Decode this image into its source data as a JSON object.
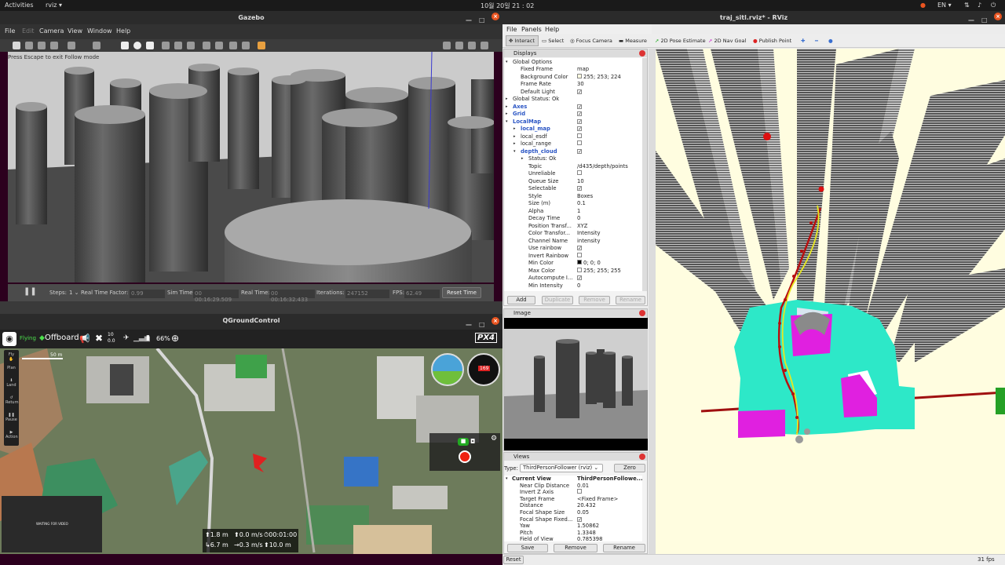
{
  "topbar": {
    "activities": "Activities",
    "app": "rviz ▾",
    "clock": "10월 20일 21 : 02",
    "lang": "EN ▾"
  },
  "gazebo": {
    "title": "Gazebo",
    "menu": [
      "File",
      "Edit",
      "Camera",
      "View",
      "Window",
      "Help"
    ],
    "hint": "Press Escape to exit Follow mode",
    "status": {
      "steps_label": "Steps:",
      "steps_value": "1 ⌄",
      "rtf_label": "Real Time Factor:",
      "rtf_value": "0.99",
      "sim_label": "Sim Time:",
      "sim_value": "00 00:16:29.509",
      "real_label": "Real Time:",
      "real_value": "00 00:16:32.433",
      "iter_label": "Iterations:",
      "iter_value": "247152",
      "fps_label": "FPS:",
      "fps_value": "62.49",
      "reset": "Reset Time"
    }
  },
  "qgc": {
    "title": "QGroundControl",
    "flying": "Flying",
    "mode": "Offboard",
    "sats": "10",
    "hdop": "0.0",
    "battery": "66%",
    "brand": "PX4",
    "scale": "50 m",
    "tools": [
      "Fly",
      "Plan",
      "Land",
      "Return",
      "Pause",
      "Action"
    ],
    "compass": "169",
    "video": "WAITING FOR VIDEO",
    "telemetry": {
      "alt_rel": "⬆1.8 m",
      "vspeed": "⬆0.0 m/s",
      "time": "⏱00:01:00",
      "dist": "↳6.7 m",
      "hspeed": "→0.3 m/s",
      "alt_amsl": "⬆10.0 m"
    }
  },
  "rviz": {
    "title": "traj_sitl.rviz* - RViz",
    "menu": [
      "File",
      "Panels",
      "Help"
    ],
    "tools": [
      "Interact",
      "Select",
      "Focus Camera",
      "Measure",
      "2D Pose Estimate",
      "2D Nav Goal",
      "Publish Point"
    ],
    "displays": {
      "title": "Displays",
      "rows": [
        {
          "k": "Global Options",
          "v": "",
          "indent": 1,
          "arrow": "▾"
        },
        {
          "k": "Fixed Frame",
          "v": "map",
          "indent": 2
        },
        {
          "k": "Background Color",
          "v": "255; 253; 224",
          "indent": 2,
          "swatch": "#fffde0"
        },
        {
          "k": "Frame Rate",
          "v": "30",
          "indent": 2
        },
        {
          "k": "Default Light",
          "v": "✓",
          "indent": 2,
          "check": true
        },
        {
          "k": "Global Status: Ok",
          "v": "",
          "indent": 1,
          "arrow": "▸"
        },
        {
          "k": "Axes",
          "v": "✓",
          "indent": 1,
          "arrow": "▸",
          "blue": true,
          "check": true
        },
        {
          "k": "Grid",
          "v": "✓",
          "indent": 1,
          "arrow": "▸",
          "blue": true,
          "check": true
        },
        {
          "k": "LocalMap",
          "v": "✓",
          "indent": 1,
          "arrow": "▾",
          "blue": true,
          "check": true
        },
        {
          "k": "local_map",
          "v": "✓",
          "indent": 2,
          "arrow": "▸",
          "blue": true,
          "check": true
        },
        {
          "k": "local_esdf",
          "v": "",
          "indent": 2,
          "arrow": "▸",
          "check": true
        },
        {
          "k": "local_range",
          "v": "",
          "indent": 2,
          "arrow": "▸",
          "check": true
        },
        {
          "k": "depth_cloud",
          "v": "✓",
          "indent": 2,
          "arrow": "▾",
          "blue": true,
          "check": true
        },
        {
          "k": "Status: Ok",
          "v": "",
          "indent": 3,
          "arrow": "▸"
        },
        {
          "k": "Topic",
          "v": "/d435/depth/points",
          "indent": 3
        },
        {
          "k": "Unreliable",
          "v": "",
          "indent": 3,
          "check": true
        },
        {
          "k": "Queue Size",
          "v": "10",
          "indent": 3
        },
        {
          "k": "Selectable",
          "v": "✓",
          "indent": 3,
          "check": true
        },
        {
          "k": "Style",
          "v": "Boxes",
          "indent": 3
        },
        {
          "k": "Size (m)",
          "v": "0.1",
          "indent": 3
        },
        {
          "k": "Alpha",
          "v": "1",
          "indent": 3
        },
        {
          "k": "Decay Time",
          "v": "0",
          "indent": 3
        },
        {
          "k": "Position Transf...",
          "v": "XYZ",
          "indent": 3
        },
        {
          "k": "Color Transfor...",
          "v": "Intensity",
          "indent": 3
        },
        {
          "k": "Channel Name",
          "v": "intensity",
          "indent": 3
        },
        {
          "k": "Use rainbow",
          "v": "✓",
          "indent": 3,
          "check": true
        },
        {
          "k": "Invert Rainbow",
          "v": "",
          "indent": 3,
          "check": true
        },
        {
          "k": "Min Color",
          "v": "0; 0; 0",
          "indent": 3,
          "swatch": "#000000"
        },
        {
          "k": "Max Color",
          "v": "255; 255; 255",
          "indent": 3,
          "swatch": "#ffffff"
        },
        {
          "k": "Autocompute I...",
          "v": "✓",
          "indent": 3,
          "check": true
        },
        {
          "k": "Min Intensity",
          "v": "0",
          "indent": 3
        }
      ],
      "buttons": [
        "Add",
        "Duplicate",
        "Remove",
        "Rename"
      ]
    },
    "image": {
      "title": "Image"
    },
    "views": {
      "title": "Views",
      "type_label": "Type:",
      "type_value": "ThirdPersonFollower (rviz)",
      "zero": "Zero",
      "rows": [
        {
          "k": "Current View",
          "v": "ThirdPersonFollowe...",
          "bold": true,
          "arrow": "▾"
        },
        {
          "k": "Near Clip Distance",
          "v": "0.01"
        },
        {
          "k": "Invert Z Axis",
          "v": "",
          "check": true
        },
        {
          "k": "Target Frame",
          "v": "<Fixed Frame>"
        },
        {
          "k": "Distance",
          "v": "20.432"
        },
        {
          "k": "Focal Shape Size",
          "v": "0.05"
        },
        {
          "k": "Focal Shape Fixed...",
          "v": "✓",
          "check": true
        },
        {
          "k": "Yaw",
          "v": "1.50862"
        },
        {
          "k": "Pitch",
          "v": "1.3348"
        },
        {
          "k": "Field of View",
          "v": "0.785398"
        }
      ],
      "buttons": [
        "Save",
        "Remove",
        "Rename"
      ]
    },
    "reset": "Reset",
    "fps": "31 fps"
  }
}
